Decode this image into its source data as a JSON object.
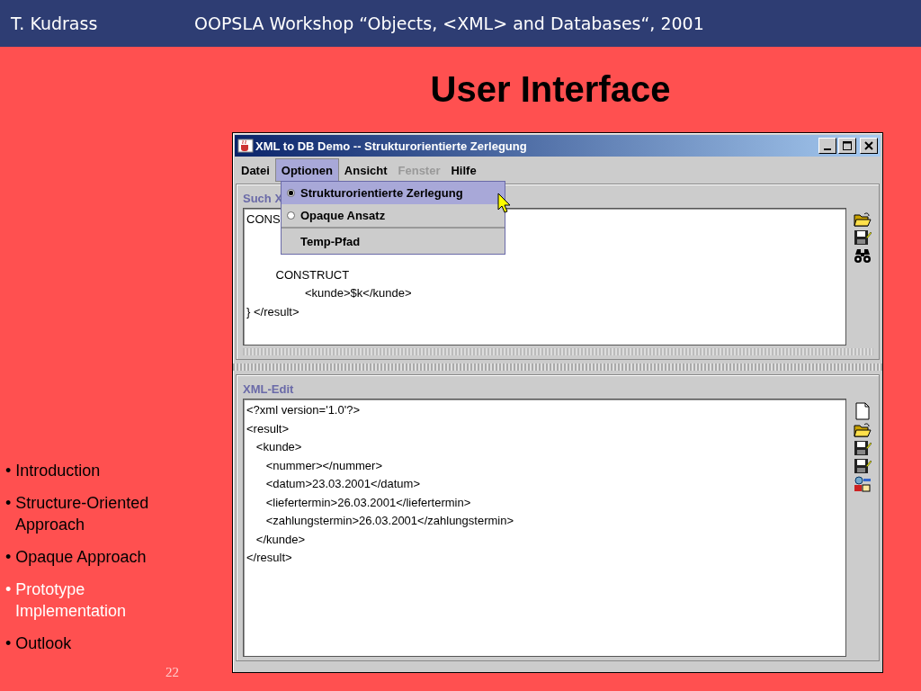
{
  "slide_header": {
    "author": "T. Kudrass",
    "event": "OOPSLA Workshop “Objects, <XML> and Databases“, 2001"
  },
  "slide_title": "User Interface",
  "outline": [
    {
      "text": "• Introduction",
      "selected": false
    },
    {
      "text": "• Structure-Oriented Approach",
      "selected": false
    },
    {
      "text": "• Opaque Approach",
      "selected": false
    },
    {
      "text": "• Prototype Implementation",
      "selected": true
    },
    {
      "text": "• Outlook",
      "selected": false
    }
  ],
  "page_number": "22",
  "window": {
    "title": "XML to DB Demo -- Strukturorientierte Zerlegung"
  },
  "menu_bar": [
    {
      "label": "Datei",
      "selected": false,
      "disabled": false
    },
    {
      "label": "Optionen",
      "selected": true,
      "disabled": false
    },
    {
      "label": "Ansicht",
      "selected": false,
      "disabled": false
    },
    {
      "label": "Fenster",
      "selected": false,
      "disabled": true
    },
    {
      "label": "Hilfe",
      "selected": false,
      "disabled": false
    }
  ],
  "open_menu": [
    {
      "kind": "radio",
      "label": "Strukturorientierte Zerlegung",
      "checked": true,
      "selected": true
    },
    {
      "kind": "radio",
      "label": "Opaque Ansatz",
      "checked": false,
      "selected": false
    },
    {
      "kind": "item",
      "label": "Temp-Pfad",
      "selected": false
    }
  ],
  "query_panel": {
    "label": "Such X",
    "text_top": [
      "CONS"
    ],
    "text_bottom": [
      "         CONSTRUCT",
      "                  <kunde>$k</kunde>",
      "} </result>"
    ]
  },
  "xml_panel": {
    "label": "XML-Edit",
    "lines": [
      "<?xml version='1.0'?>",
      "<result>",
      "   <kunde>",
      "      <nummer></nummer>",
      "      <datum>23.03.2001</datum>",
      "      <liefertermin>26.03.2001</liefertermin>",
      "      <zahlungstermin>26.03.2001</zahlungstermin>",
      "   </kunde>",
      "</result>"
    ]
  }
}
